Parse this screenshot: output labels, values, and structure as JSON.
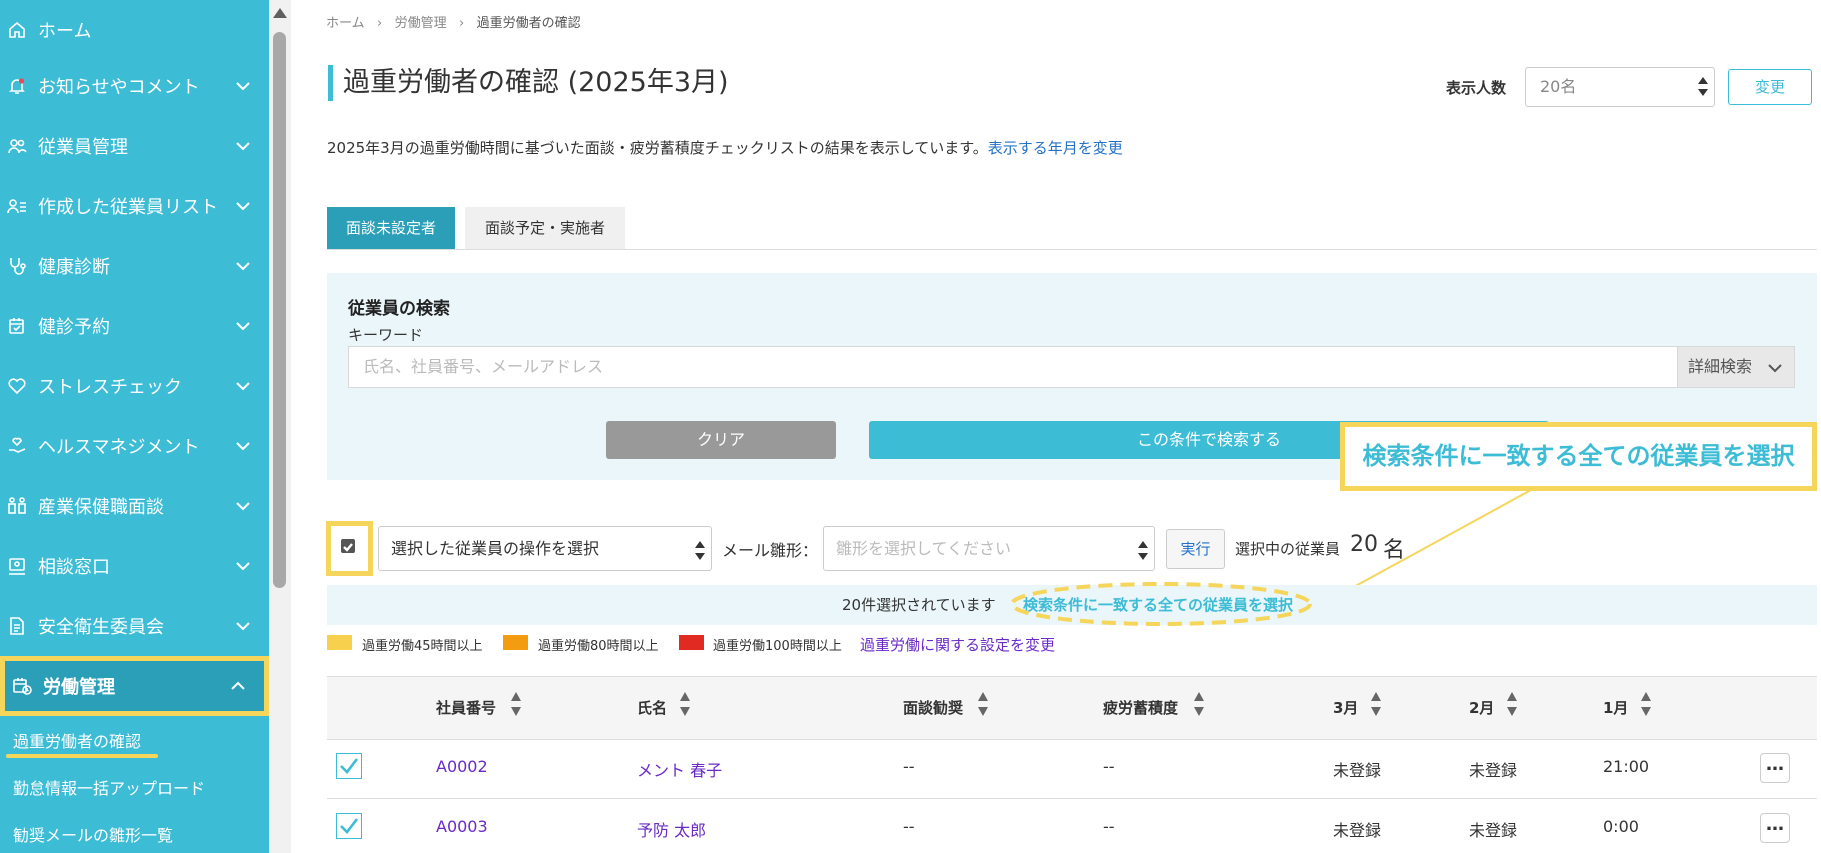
{
  "sidebar": {
    "items": [
      {
        "label": "ホーム",
        "icon": "home-icon"
      },
      {
        "label": "お知らせやコメント",
        "icon": "bell-icon"
      },
      {
        "label": "従業員管理",
        "icon": "people-icon"
      },
      {
        "label": "作成した従業員リスト",
        "icon": "user-list-icon"
      },
      {
        "label": "健康診断",
        "icon": "stethoscope-icon"
      },
      {
        "label": "健診予約",
        "icon": "calendar-check-icon"
      },
      {
        "label": "ストレスチェック",
        "icon": "heart-icon"
      },
      {
        "label": "ヘルスマネジメント",
        "icon": "hand-heart-icon"
      },
      {
        "label": "産業保健職面談",
        "icon": "meeting-icon"
      },
      {
        "label": "相談窓口",
        "icon": "consult-icon"
      },
      {
        "label": "安全衛生委員会",
        "icon": "document-icon"
      },
      {
        "label": "労働管理",
        "icon": "calendar-clock-icon"
      }
    ],
    "sub_items": [
      "過重労働者の確認",
      "勤怠情報一括アップロード",
      "勧奨メールの雛形一覧"
    ]
  },
  "breadcrumb": [
    "ホーム",
    "労働管理",
    "過重労働者の確認"
  ],
  "page": {
    "title": "過重労働者の確認 (2025年3月)",
    "description": "2025年3月の過重労働時間に基づいた面談・疲労蓄積度チェックリストの結果を表示しています。",
    "description_link": "表示する年月を変更",
    "count_label": "表示人数",
    "count_value": "20名",
    "change_button": "変更"
  },
  "tabs": [
    "面談未設定者",
    "面談予定・実施者"
  ],
  "search": {
    "title": "従業員の検索",
    "keyword_label": "キーワード",
    "placeholder": "氏名、社員番号、メールアドレス",
    "detail_button": "詳細検索",
    "clear_button": "クリア",
    "search_button": "この条件で検索する"
  },
  "callout": "検索条件に一致する全ての従業員を選択",
  "actions": {
    "action_select": "選択した従業員の操作を選択",
    "mail_label": "メール雛形：",
    "mail_placeholder": "雛形を選択してください",
    "run_button": "実行",
    "selected_label": "選択中の従業員",
    "selected_count": "20",
    "selected_unit": "名"
  },
  "info_bar": {
    "text": "20件選択されています",
    "link": "検索条件に一致する全ての従業員を選択"
  },
  "legend": [
    {
      "label": "過重労働45時間以上",
      "color": "#f7d04e"
    },
    {
      "label": "過重労働80時間以上",
      "color": "#f39c12"
    },
    {
      "label": "過重労働100時間以上",
      "color": "#e02a22"
    }
  ],
  "legend_link": "過重労働に関する設定を変更",
  "table": {
    "headers": [
      "社員番号",
      "氏名",
      "面談勧奨",
      "疲労蓄積度",
      "3月",
      "2月",
      "1月"
    ],
    "rows": [
      {
        "id": "A0002",
        "name": "メント 春子",
        "interview": "--",
        "fatigue": "--",
        "m3": "未登録",
        "m2": "未登録",
        "m1": "21:00",
        "more": "…"
      },
      {
        "id": "A0003",
        "name": "予防 太郎",
        "interview": "--",
        "fatigue": "--",
        "m3": "未登録",
        "m2": "未登録",
        "m1": "0:00",
        "more": "…"
      }
    ]
  },
  "colors": {
    "sidebar": "#3dbcd6",
    "sidebar_active": "#2b9fb8",
    "highlight": "#f5d55a",
    "link": "#2472c8",
    "purple_link": "#6a2bc8"
  }
}
